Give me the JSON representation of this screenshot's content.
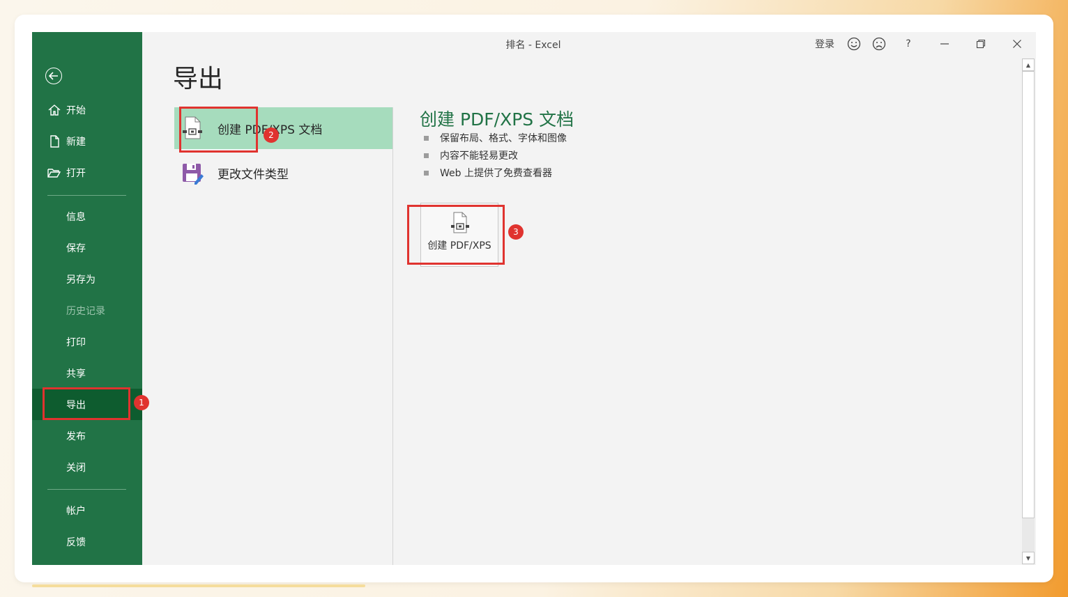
{
  "window": {
    "title": "排名  -  Excel",
    "login_label": "登录",
    "help_label": "?"
  },
  "sidebar": {
    "items": [
      {
        "label": "开始",
        "icon": "home-icon"
      },
      {
        "label": "新建",
        "icon": "new-document-icon"
      },
      {
        "label": "打开",
        "icon": "open-folder-icon"
      },
      {
        "label": "信息"
      },
      {
        "label": "保存"
      },
      {
        "label": "另存为"
      },
      {
        "label": "历史记录",
        "disabled": true
      },
      {
        "label": "打印"
      },
      {
        "label": "共享"
      },
      {
        "label": "导出",
        "active": true
      },
      {
        "label": "发布"
      },
      {
        "label": "关闭"
      },
      {
        "label": "帐户"
      },
      {
        "label": "反馈"
      }
    ]
  },
  "main": {
    "page_title": "导出",
    "options": [
      {
        "label": "创建 PDF/XPS 文档",
        "selected": true
      },
      {
        "label": "更改文件类型",
        "selected": false
      }
    ],
    "detail": {
      "title": "创建 PDF/XPS 文档",
      "bullets": [
        "保留布局、格式、字体和图像",
        "内容不能轻易更改",
        "Web 上提供了免费查看器"
      ],
      "create_button_label": "创建 PDF/XPS"
    }
  },
  "annotations": {
    "badge_1": "1",
    "badge_2": "2",
    "badge_3": "3",
    "highlight_color": "#e0332f"
  },
  "colors": {
    "sidebar_bg": "#217346",
    "sidebar_active": "#0e5c2f",
    "selected_option": "#a6dcbd",
    "accent_text": "#217346"
  }
}
